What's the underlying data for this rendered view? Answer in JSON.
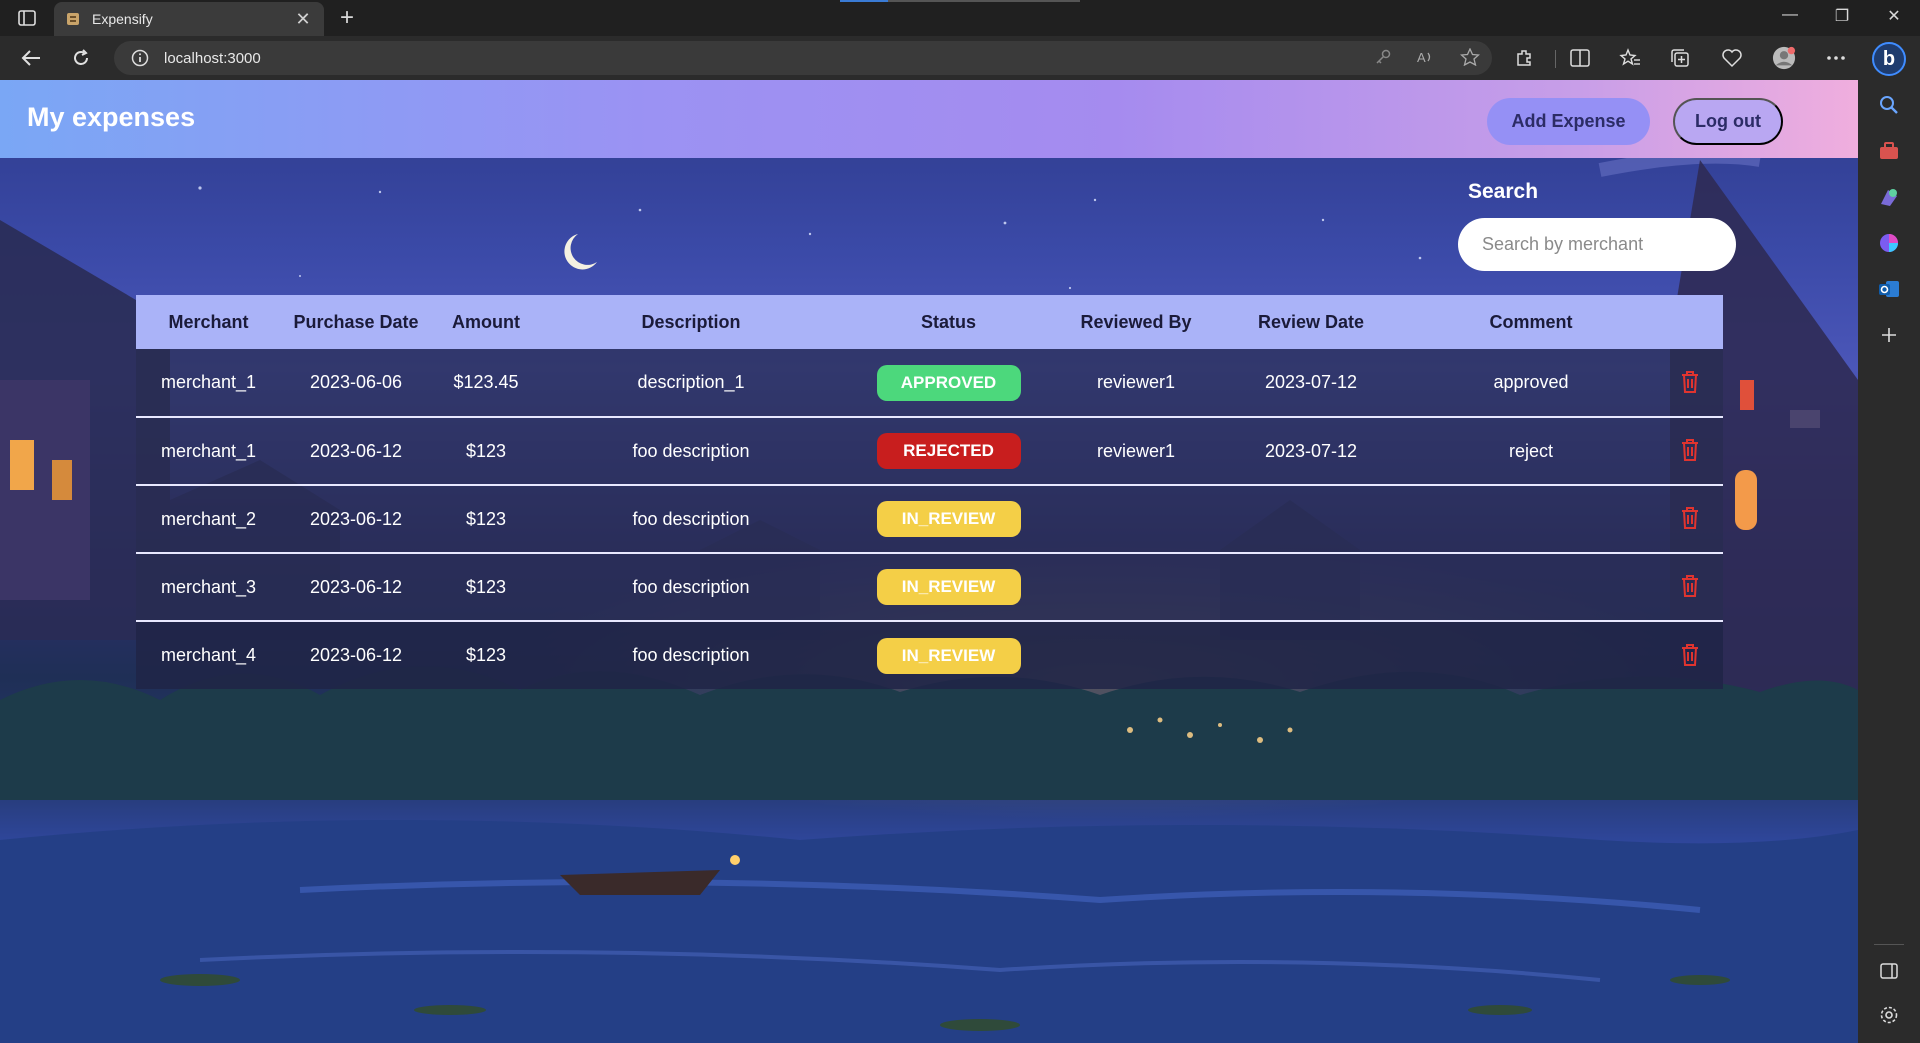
{
  "browser": {
    "tab_title": "Expensify",
    "url": "localhost:3000"
  },
  "colors": {
    "header_gradient_start": "#7aa7f5",
    "header_gradient_end": "#f0aede",
    "approved": "#4cd87c",
    "rejected": "#c81e1e",
    "in_review": "#f4cf47",
    "delete": "#e0342f"
  },
  "header": {
    "title": "My expenses",
    "add_expense_label": "Add Expense",
    "logout_label": "Log out"
  },
  "search": {
    "label": "Search",
    "placeholder": "Search by merchant",
    "value": ""
  },
  "table": {
    "columns": [
      "Merchant",
      "Purchase Date",
      "Amount",
      "Description",
      "Status",
      "Reviewed By",
      "Review Date",
      "Comment"
    ],
    "rows": [
      {
        "merchant": "merchant_1",
        "purchase_date": "2023-06-06",
        "amount": "$123.45",
        "description": "description_1",
        "status": "APPROVED",
        "status_class": "approved",
        "reviewed_by": "reviewer1",
        "review_date": "2023-07-12",
        "comment": "approved"
      },
      {
        "merchant": "merchant_1",
        "purchase_date": "2023-06-12",
        "amount": "$123",
        "description": "foo description",
        "status": "REJECTED",
        "status_class": "rejected",
        "reviewed_by": "reviewer1",
        "review_date": "2023-07-12",
        "comment": "reject"
      },
      {
        "merchant": "merchant_2",
        "purchase_date": "2023-06-12",
        "amount": "$123",
        "description": "foo description",
        "status": "IN_REVIEW",
        "status_class": "review",
        "reviewed_by": "",
        "review_date": "",
        "comment": ""
      },
      {
        "merchant": "merchant_3",
        "purchase_date": "2023-06-12",
        "amount": "$123",
        "description": "foo description",
        "status": "IN_REVIEW",
        "status_class": "review",
        "reviewed_by": "",
        "review_date": "",
        "comment": ""
      },
      {
        "merchant": "merchant_4",
        "purchase_date": "2023-06-12",
        "amount": "$123",
        "description": "foo description",
        "status": "IN_REVIEW",
        "status_class": "review",
        "reviewed_by": "",
        "review_date": "",
        "comment": ""
      }
    ],
    "delete_icon": "trash-icon"
  }
}
